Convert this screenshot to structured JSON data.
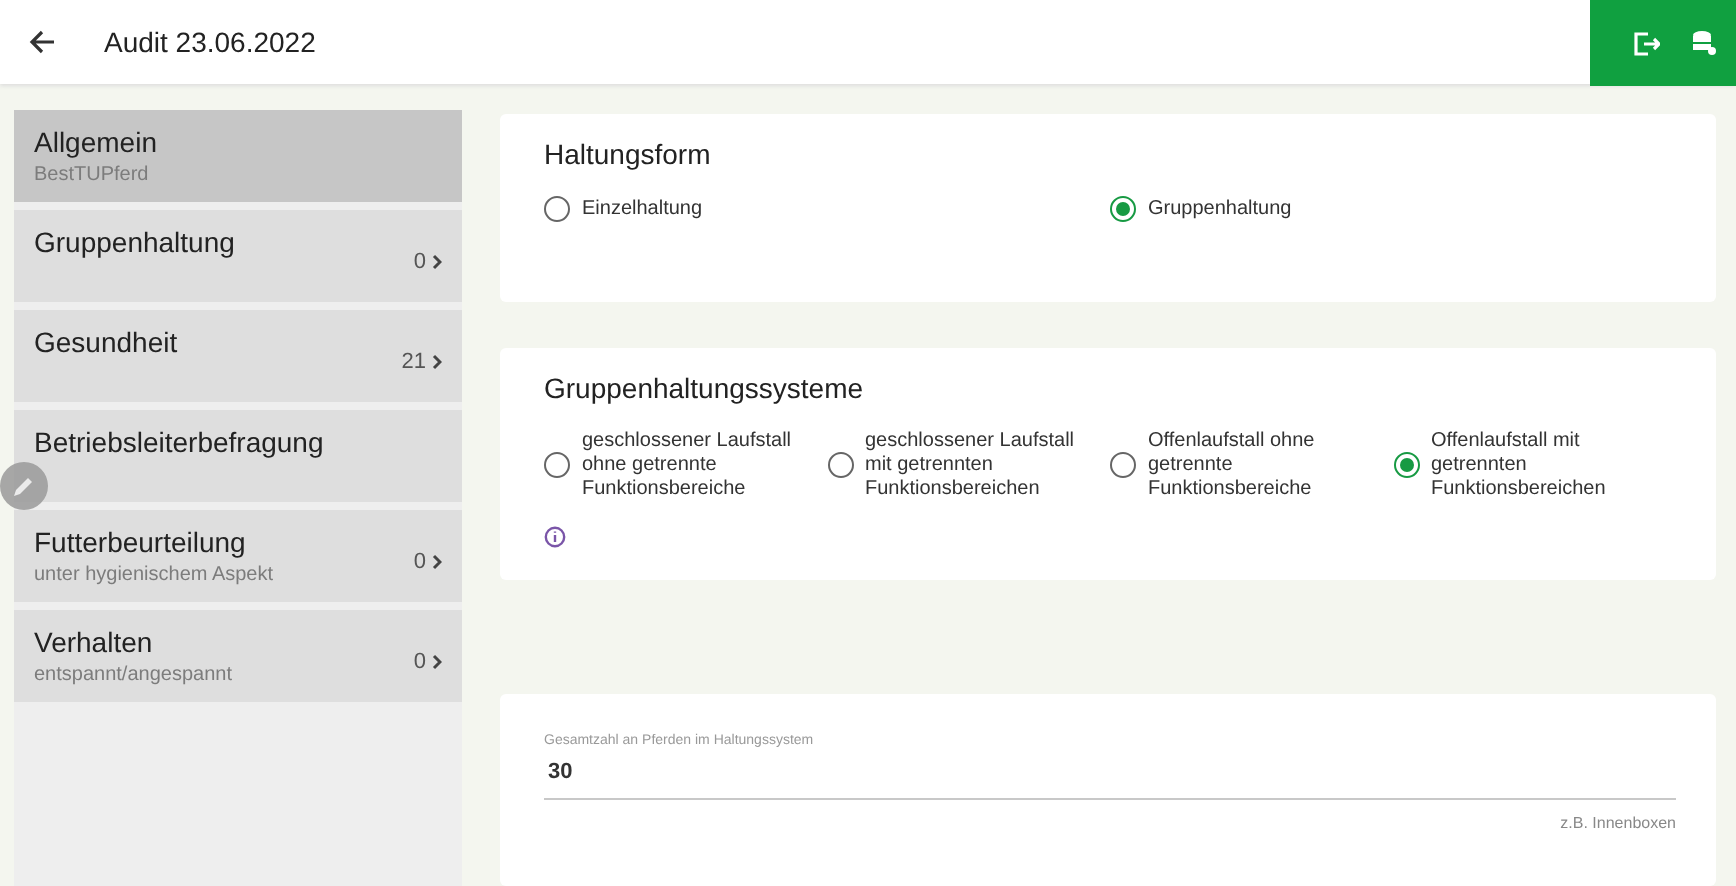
{
  "header": {
    "title": "Audit 23.06.2022"
  },
  "sidebar": {
    "items": [
      {
        "title": "Allgemein",
        "subtitle": "BestTUPferd",
        "selected": true
      },
      {
        "title": "Gruppenhaltung",
        "count": "0",
        "selected": false
      },
      {
        "title": "Gesundheit",
        "count": "21",
        "selected": false
      },
      {
        "title": "Betriebsleiterbefragung",
        "selected": false
      },
      {
        "title": "Futterbeurteilung",
        "subtitle": "unter hygienischem Aspekt",
        "count": "0",
        "selected": false
      },
      {
        "title": "Verhalten",
        "subtitle": "entspannt/angespannt",
        "count": "0",
        "selected": false
      }
    ]
  },
  "sections": [
    {
      "title": "Haltungsform",
      "options": [
        {
          "label": "Einzelhaltung",
          "selected": false
        },
        {
          "label": "Gruppenhaltung",
          "selected": true
        }
      ]
    },
    {
      "title": "Gruppenhaltungssysteme",
      "info": true,
      "options": [
        {
          "label": "geschlossener Laufstall ohne getrennte Funktionsbereiche",
          "selected": false
        },
        {
          "label": "geschlossener Laufstall mit getrennten Funktionsbereichen",
          "selected": false
        },
        {
          "label": "Offenlaufstall ohne getrennte Funktionsbereiche",
          "selected": false
        },
        {
          "label": "Offenlaufstall mit getrennten Funktionsbereichen",
          "selected": true
        }
      ]
    }
  ],
  "field": {
    "label": "Gesamtzahl an Pferden im Haltungssystem",
    "value": "30",
    "hint": "z.B. Innenboxen"
  }
}
